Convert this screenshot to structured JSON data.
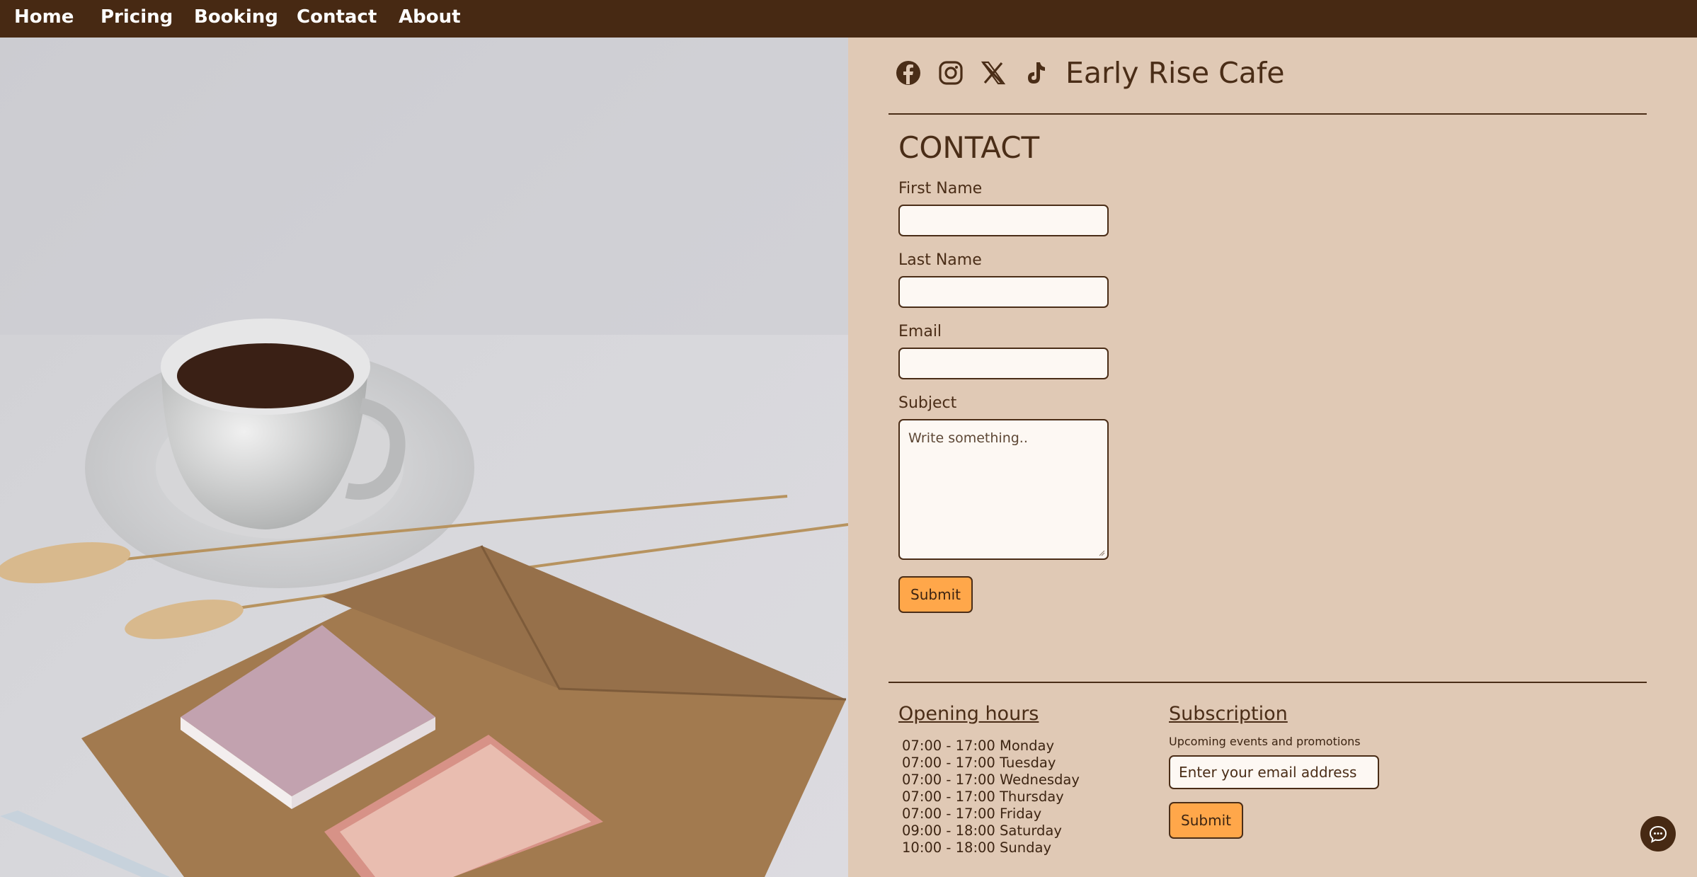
{
  "nav": {
    "items": [
      {
        "label": "Home"
      },
      {
        "label": "Pricing"
      },
      {
        "label": "Booking"
      },
      {
        "label": "Contact"
      },
      {
        "label": "About"
      }
    ]
  },
  "header": {
    "social_icons": [
      "facebook-icon",
      "instagram-icon",
      "x-icon",
      "tiktok-icon"
    ],
    "brand": "Early Rise Cafe"
  },
  "contact": {
    "title": "CONTACT",
    "fields": {
      "first_name_label": "First Name",
      "last_name_label": "Last Name",
      "email_label": "Email",
      "subject_label": "Subject",
      "subject_placeholder": "Write something.."
    },
    "submit_label": "Submit"
  },
  "footer": {
    "hours_title": "Opening hours",
    "hours": [
      "07:00 - 17:00 Monday",
      "07:00 - 17:00 Tuesday",
      "07:00 - 17:00 Wednesday",
      "07:00 - 17:00 Thursday",
      "07:00 - 17:00 Friday",
      "09:00 - 18:00 Saturday",
      "10:00 - 18:00 Sunday"
    ],
    "subscription_title": "Subscription",
    "subscription_caption": "Upcoming events and promotions",
    "email_placeholder": "Enter your email address",
    "submit_label": "Submit"
  },
  "colors": {
    "nav_bg": "#472913",
    "panel_bg": "#e0c9b5",
    "accent": "#ffa74a",
    "text": "#4a2d17"
  },
  "chat_icon": "chat-bubble-icon"
}
